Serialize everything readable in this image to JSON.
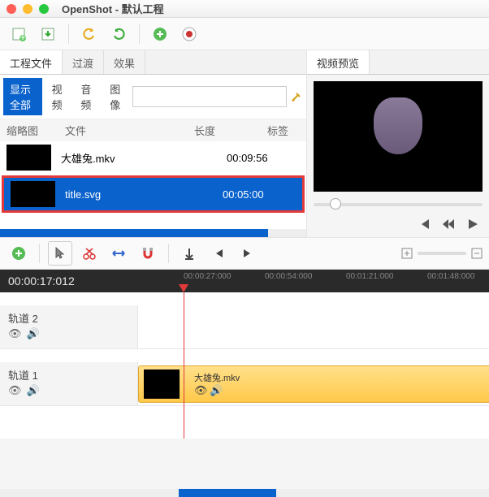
{
  "window": {
    "title": "OpenShot - 默认工程"
  },
  "tabs": {
    "project": "工程文件",
    "transition": "过渡",
    "effect": "效果",
    "preview": "视频预览"
  },
  "filters": {
    "all": "显示全部",
    "video": "视频",
    "audio": "音频",
    "image": "图像"
  },
  "cols": {
    "thumb": "缩略图",
    "file": "文件",
    "len": "长度",
    "tag": "标签"
  },
  "files": [
    {
      "name": "大雄兔.mkv",
      "len": "00:09:56"
    },
    {
      "name": "title.svg",
      "len": "00:05:00"
    }
  ],
  "timeline": {
    "current": "00:00:17:012",
    "ticks": [
      "00:00:27:000",
      "00:00:54:000",
      "00:01:21:000",
      "00:01:48:000"
    ],
    "tracks": [
      {
        "label": "轨道 2"
      },
      {
        "label": "轨道 1"
      }
    ],
    "clip": {
      "name": "大雄兔.mkv"
    }
  }
}
